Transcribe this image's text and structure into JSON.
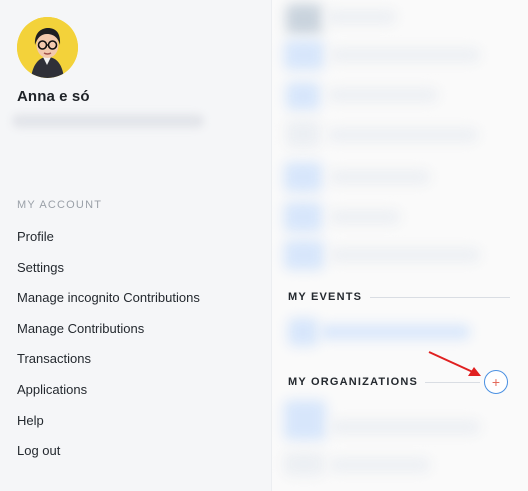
{
  "profile": {
    "name": "Anna e só"
  },
  "my_account": {
    "section_title": "MY ACCOUNT",
    "items": [
      {
        "label": "Profile"
      },
      {
        "label": "Settings"
      },
      {
        "label": "Manage incognito Contributions"
      },
      {
        "label": "Manage Contributions"
      },
      {
        "label": "Transactions"
      },
      {
        "label": "Applications"
      },
      {
        "label": "Help"
      },
      {
        "label": "Log out"
      }
    ]
  },
  "events": {
    "title": "MY EVENTS"
  },
  "organizations": {
    "title": "MY ORGANIZATIONS",
    "add_label": "+"
  },
  "colors": {
    "avatar_bg": "#f3d23a",
    "accent_blue": "#4a90e2",
    "annotation_arrow": "#e02020"
  },
  "icons": {
    "add": "plus-icon",
    "annotation": "arrow-icon"
  }
}
